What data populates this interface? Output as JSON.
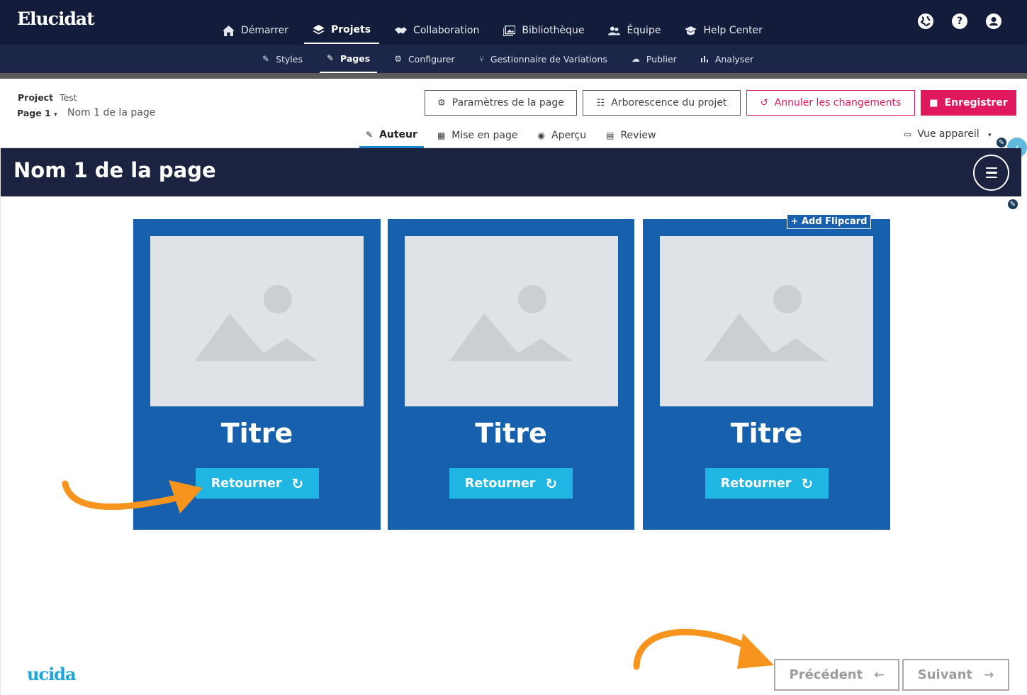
{
  "app": {
    "logo": "Elucidat"
  },
  "main_nav": [
    {
      "label": "Démarrer",
      "icon": "home-icon"
    },
    {
      "label": "Projets",
      "icon": "layers-icon",
      "active": true
    },
    {
      "label": "Collaboration",
      "icon": "handshake-icon"
    },
    {
      "label": "Bibliothèque",
      "icon": "images-icon"
    },
    {
      "label": "Équipe",
      "icon": "users-icon"
    },
    {
      "label": "Help Center",
      "icon": "graduation-cap-icon"
    }
  ],
  "top_icons": [
    "globe-icon",
    "help-icon",
    "account-icon"
  ],
  "sub_nav": [
    {
      "label": "Styles",
      "icon": "brush-icon"
    },
    {
      "label": "Pages",
      "icon": "pencil-icon",
      "active": true
    },
    {
      "label": "Configurer",
      "icon": "gear-icon"
    },
    {
      "label": "Gestionnaire de Variations",
      "icon": "branch-icon"
    },
    {
      "label": "Publier",
      "icon": "cloud-upload-icon"
    },
    {
      "label": "Analyser",
      "icon": "bar-chart-icon"
    }
  ],
  "editor": {
    "project_label": "Project",
    "project_name": "Test",
    "page_selector": "Page 1",
    "page_name": "Nom 1 de la page",
    "buttons": {
      "page_settings": "Paramètres de la page",
      "project_tree": "Arborescence du projet",
      "undo": "Annuler les changements",
      "save": "Enregistrer"
    },
    "modes": [
      {
        "label": "Auteur",
        "icon": "pencil-icon",
        "active": true
      },
      {
        "label": "Mise en page",
        "icon": "grid-icon"
      },
      {
        "label": "Aperçu",
        "icon": "eye-icon"
      },
      {
        "label": "Review",
        "icon": "comment-icon"
      }
    ],
    "device_view": "Vue appareil"
  },
  "page": {
    "title": "Nom 1 de la page",
    "add_flipcard": "+ Add Flipcard",
    "cards": [
      {
        "title": "Titre",
        "flip_label": "Retourner"
      },
      {
        "title": "Titre",
        "flip_label": "Retourner"
      },
      {
        "title": "Titre",
        "flip_label": "Retourner"
      }
    ],
    "prev_label": "Précédent",
    "next_label": "Suivant",
    "footer_logo": "ucida"
  },
  "colors": {
    "nav_dark": "#131c3a",
    "accent_pink": "#e0195f",
    "card_blue": "#1760ad",
    "button_cyan": "#1fb6e3",
    "annotation_orange": "#f7941d"
  }
}
